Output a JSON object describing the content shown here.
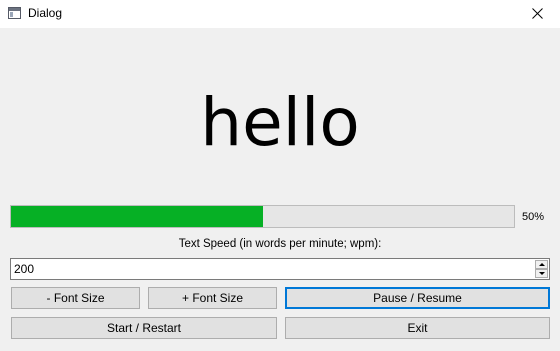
{
  "window": {
    "title": "Dialog",
    "icon": "window-app-icon",
    "close_icon": "close-icon"
  },
  "display": {
    "word": "hello"
  },
  "progress": {
    "value": 50,
    "label": "50%",
    "fill_color": "#06b025"
  },
  "speed": {
    "label": "Text Speed (in words per minute; wpm):",
    "value": "200",
    "up_icon": "chevron-up-icon",
    "down_icon": "chevron-down-icon"
  },
  "buttons": {
    "font_minus": "- Font Size",
    "font_plus": "+ Font Size",
    "pause_resume": "Pause / Resume",
    "start_restart": "Start / Restart",
    "exit": "Exit"
  },
  "colors": {
    "background": "#f0f0f0",
    "focus_accent": "#0078d7"
  }
}
